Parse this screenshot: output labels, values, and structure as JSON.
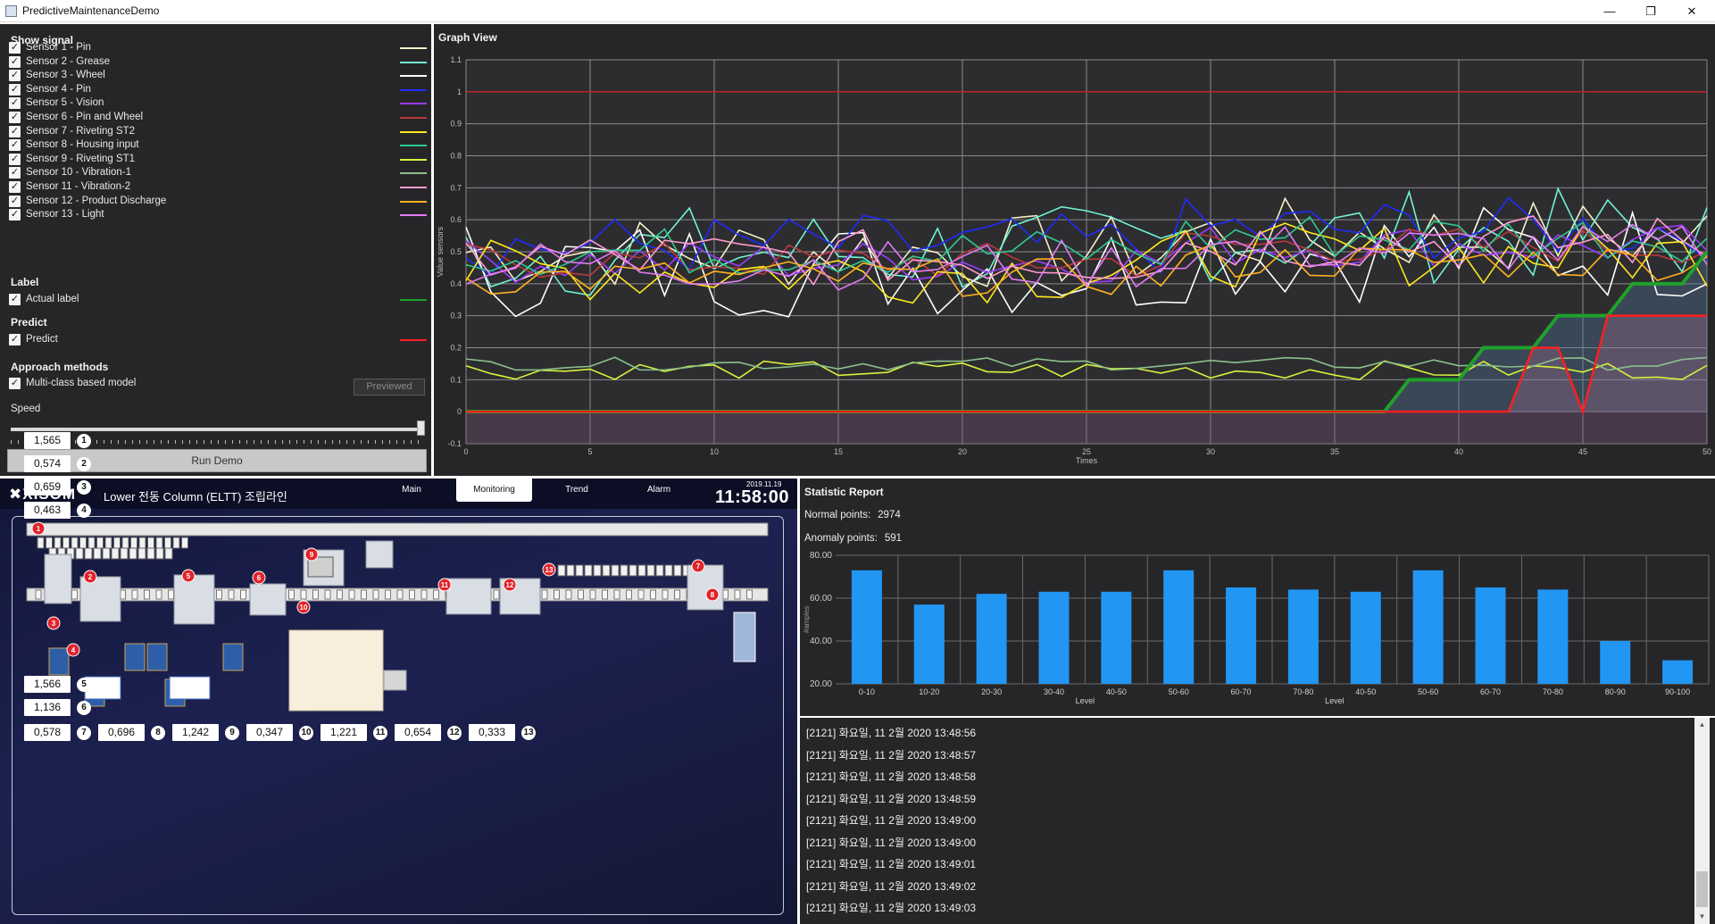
{
  "window": {
    "title": "PredictiveMaintenanceDemo",
    "minimize": "—",
    "restore": "❐",
    "close": "✕"
  },
  "controls": {
    "show_signal_title": "Show signal",
    "signals": [
      {
        "label": "Sensor 1 - Pin",
        "color": "#f5f0c8"
      },
      {
        "label": "Sensor 2 - Grease",
        "color": "#6ff2d2"
      },
      {
        "label": "Sensor 3 - Wheel",
        "color": "#ffffff"
      },
      {
        "label": "Sensor 4 - Pin",
        "color": "#1f2bff"
      },
      {
        "label": "Sensor 5 - Vision",
        "color": "#9b3cff"
      },
      {
        "label": "Sensor 6 - Pin and Wheel",
        "color": "#b83a3a"
      },
      {
        "label": "Sensor 7 - Riveting ST2",
        "color": "#ffe81e"
      },
      {
        "label": "Sensor 8 - Housing input",
        "color": "#2ec98f"
      },
      {
        "label": "Sensor 9 - Riveting ST1",
        "color": "#d8f23a"
      },
      {
        "label": "Sensor 10 - Vibration-1",
        "color": "#8cbf8c"
      },
      {
        "label": "Sensor 11 - Vibration-2",
        "color": "#ff9ad2"
      },
      {
        "label": "Sensor 12 - Product Discharge",
        "color": "#ffb21e"
      },
      {
        "label": "Sensor 13 - Light",
        "color": "#e27af2"
      }
    ],
    "label_title": "Label",
    "actual_label": {
      "label": "Actual label",
      "color": "#1fa12a"
    },
    "predict_title": "Predict",
    "predict": {
      "label": "Predict",
      "color": "#ff1f1f"
    },
    "approach_title": "Approach methods",
    "approach_option": "Multi-class based model",
    "previewed_button": "Previewed",
    "speed_label": "Speed",
    "speed_value": 1.0,
    "run_button": "Run Demo"
  },
  "graph": {
    "title": "Graph View",
    "chart_data": {
      "type": "line",
      "xlabel": "Times",
      "ylabel": "Value sensors",
      "xlim": [
        0,
        50
      ],
      "ylim": [
        -0.1,
        1.1
      ],
      "xticks": [
        "0",
        "5",
        "10",
        "15",
        "20",
        "25",
        "30",
        "35",
        "40",
        "45",
        "50"
      ],
      "yticks": [
        "1.1",
        "1",
        "0.9",
        "0.8",
        "0.7",
        "0.6",
        "0.5",
        "0.4",
        "0.3",
        "0.2",
        "0.1",
        "0",
        "-0.1"
      ],
      "threshold": 1.0,
      "threshold_color": "#d02020",
      "sensor_bands": [
        {
          "color": "#f5f0c8",
          "base": 0.5,
          "spread": 0.12
        },
        {
          "color": "#6ff2d2",
          "base": 0.5,
          "spread": 0.15
        },
        {
          "color": "#ffffff",
          "base": 0.45,
          "spread": 0.16
        },
        {
          "color": "#1f2bff",
          "base": 0.52,
          "spread": 0.1
        },
        {
          "color": "#9b3cff",
          "base": 0.47,
          "spread": 0.07
        },
        {
          "color": "#b83a3a",
          "base": 0.47,
          "spread": 0.06
        },
        {
          "color": "#ffe81e",
          "base": 0.44,
          "spread": 0.1
        },
        {
          "color": "#2ec98f",
          "base": 0.5,
          "spread": 0.08
        },
        {
          "color": "#d8f23a",
          "base": 0.13,
          "spread": 0.03
        },
        {
          "color": "#8cbf8c",
          "base": 0.15,
          "spread": 0.02
        },
        {
          "color": "#ff9ad2",
          "base": 0.48,
          "spread": 0.09
        },
        {
          "color": "#ffb21e",
          "base": 0.42,
          "spread": 0.06
        },
        {
          "color": "#e27af2",
          "base": 0.46,
          "spread": 0.08
        }
      ],
      "actual_label": {
        "color": "#1fa12a",
        "x": [
          0,
          37,
          38,
          40,
          41,
          43,
          44,
          46,
          47,
          49,
          50
        ],
        "y": [
          0,
          0,
          0.1,
          0.1,
          0.2,
          0.2,
          0.3,
          0.3,
          0.4,
          0.4,
          0.5
        ]
      },
      "predict": {
        "color": "#ff1f1f",
        "x": [
          0,
          42,
          43,
          44,
          45,
          46,
          47,
          48,
          49,
          50
        ],
        "y": [
          0,
          0,
          0.2,
          0.2,
          0.0,
          0.3,
          0.3,
          0.3,
          0.3,
          0.3
        ]
      }
    }
  },
  "monitor": {
    "logo": "XISOM",
    "line_title": "Lower 전동 Column (ELTT) 조립라인",
    "tabs": [
      {
        "label": "Main",
        "active": false
      },
      {
        "label": "Monitoring",
        "active": true
      },
      {
        "label": "Trend",
        "active": false
      },
      {
        "label": "Alarm",
        "active": false
      }
    ],
    "date": "2019.11.19",
    "time": "11:58:00",
    "values": [
      {
        "value": "1,565",
        "idx": "1"
      },
      {
        "value": "0,574",
        "idx": "2"
      },
      {
        "value": "0,659",
        "idx": "3"
      },
      {
        "value": "0,463",
        "idx": "4"
      },
      {
        "value": "1,566",
        "idx": "5"
      },
      {
        "value": "1,136",
        "idx": "6"
      },
      {
        "value": "0,578",
        "idx": "7"
      },
      {
        "value": "0,696",
        "idx": "8"
      },
      {
        "value": "1,242",
        "idx": "9"
      },
      {
        "value": "0,347",
        "idx": "10"
      },
      {
        "value": "1,221",
        "idx": "11"
      },
      {
        "value": "0,654",
        "idx": "12"
      },
      {
        "value": "0,333",
        "idx": "13"
      }
    ],
    "station_markers": [
      "1",
      "2",
      "3",
      "4",
      "5",
      "6",
      "7",
      "8",
      "9",
      "10",
      "11",
      "12",
      "13"
    ]
  },
  "stats": {
    "title": "Statistic Report",
    "normal_label": "Normal points:",
    "normal_value": "2974",
    "anomaly_label": "Anomaly points:",
    "anomaly_value": "591",
    "chart_data": {
      "type": "bar",
      "xlabel": "Level",
      "xlabel2": "Level",
      "ylabel": "#amples",
      "ylim": [
        20,
        80
      ],
      "yticks": [
        "80.00",
        "60.00",
        "40.00",
        "20.00"
      ],
      "categories": [
        "0-10",
        "10-20",
        "20-30",
        "30-40",
        "40-50",
        "50-60",
        "60-70",
        "70-80",
        "40-50",
        "50-60",
        "60-70",
        "70-80",
        "80-90",
        "90-100"
      ],
      "values": [
        73,
        57,
        62,
        63,
        63,
        73,
        65,
        64,
        63,
        73,
        65,
        64,
        40,
        31
      ],
      "bar_color": "#2196f3"
    }
  },
  "log": {
    "lines": [
      "[2121] 화요일, 11 2월 2020 13:48:56",
      "[2121] 화요일, 11 2월 2020 13:48:57",
      "[2121] 화요일, 11 2월 2020 13:48:58",
      "[2121] 화요일, 11 2월 2020 13:48:59",
      "[2121] 화요일, 11 2월 2020 13:49:00",
      "[2121] 화요일, 11 2월 2020 13:49:00",
      "[2121] 화요일, 11 2월 2020 13:49:01",
      "[2121] 화요일, 11 2월 2020 13:49:02",
      "[2121] 화요일, 11 2월 2020 13:49:03"
    ],
    "scroll_up": "▲",
    "scroll_down": "▼"
  }
}
